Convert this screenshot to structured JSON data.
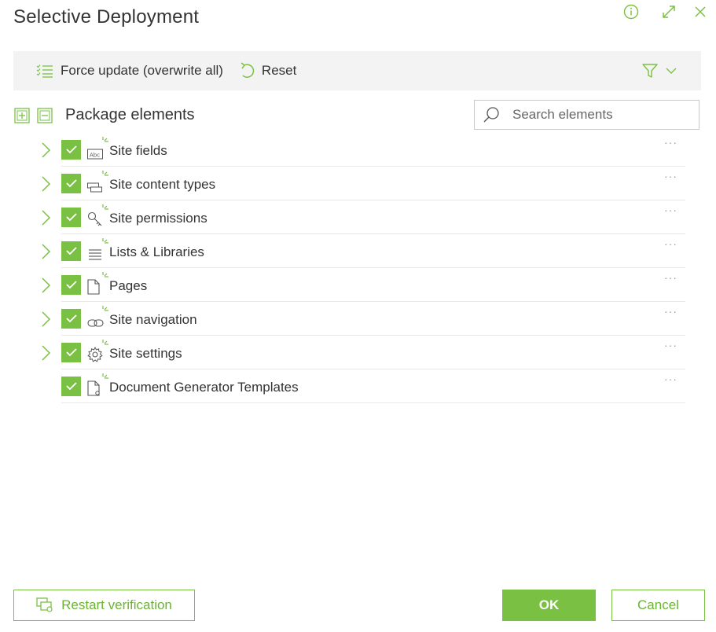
{
  "dialog": {
    "title": "Selective Deployment"
  },
  "toolbar": {
    "force_update_label": "Force update (overwrite all)",
    "reset_label": "Reset"
  },
  "tree": {
    "header_label": "Package elements",
    "search_placeholder": "Search elements",
    "items": [
      {
        "label": "Site fields",
        "icon": "text-field-icon",
        "expandable": true,
        "checked": true
      },
      {
        "label": "Site content types",
        "icon": "content-type-icon",
        "expandable": true,
        "checked": true
      },
      {
        "label": "Site permissions",
        "icon": "key-icon",
        "expandable": true,
        "checked": true
      },
      {
        "label": "Lists & Libraries",
        "icon": "list-icon",
        "expandable": true,
        "checked": true
      },
      {
        "label": "Pages",
        "icon": "page-icon",
        "expandable": true,
        "checked": true
      },
      {
        "label": "Site navigation",
        "icon": "link-icon",
        "expandable": true,
        "checked": true
      },
      {
        "label": "Site settings",
        "icon": "gear-icon",
        "expandable": true,
        "checked": true
      },
      {
        "label": "Document Generator Templates",
        "icon": "document-template-icon",
        "expandable": false,
        "checked": true
      }
    ],
    "more_label": "···"
  },
  "footer": {
    "restart_label": "Restart verification",
    "ok_label": "OK",
    "cancel_label": "Cancel"
  },
  "colors": {
    "accent": "#7ac143",
    "toolbar_bg": "#f3f3f3",
    "text": "#333333"
  }
}
